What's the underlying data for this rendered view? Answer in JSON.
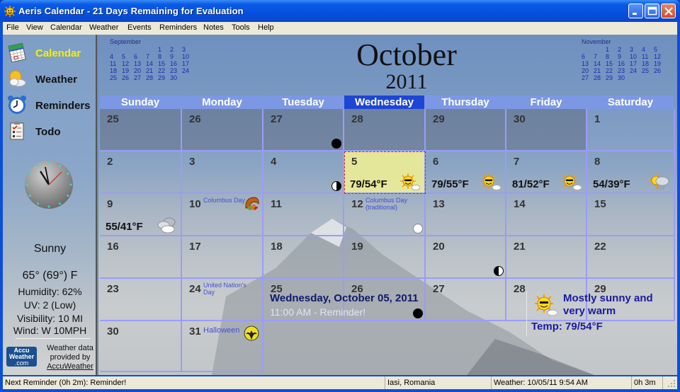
{
  "window": {
    "title": "Aeris Calendar - 21 Days Remaining for Evaluation",
    "buttons": {
      "minimize": "minimize",
      "maximize": "maximize",
      "close": "close"
    }
  },
  "menu": [
    "File",
    "View",
    "Calendar",
    "Weather",
    "Events",
    "Reminders",
    "Notes",
    "Tools",
    "Help"
  ],
  "sidebar": {
    "nav": [
      {
        "label": "Calendar",
        "icon": "calendar-icon",
        "active": true
      },
      {
        "label": "Weather",
        "icon": "weather-icon",
        "active": false
      },
      {
        "label": "Reminders",
        "icon": "alarm-clock-icon",
        "active": false
      },
      {
        "label": "Todo",
        "icon": "todo-checklist-icon",
        "active": false
      }
    ],
    "weather": {
      "condition": "Sunny",
      "temperature": "65° (69°) F",
      "humidity": "Humidity: 62%",
      "uv": "UV: 2 (Low)",
      "visibility": "Visibility: 10 MI",
      "wind": "Wind: W 10MPH"
    },
    "provider": {
      "logo_line1": "Accu",
      "logo_line2": "Weather",
      "logo_line3": ".com",
      "text1": "Weather data",
      "text2": "provided by",
      "link": "AccuWeather"
    }
  },
  "mini_calendars": {
    "prev": {
      "name": "September",
      "weeks": [
        [
          "",
          "",
          "",
          "",
          "1",
          "2",
          "3"
        ],
        [
          "4",
          "5",
          "6",
          "7",
          "8",
          "9",
          "10"
        ],
        [
          "11",
          "12",
          "13",
          "14",
          "15",
          "16",
          "17"
        ],
        [
          "18",
          "19",
          "20",
          "21",
          "22",
          "23",
          "24"
        ],
        [
          "25",
          "26",
          "27",
          "28",
          "29",
          "30",
          ""
        ]
      ]
    },
    "next": {
      "name": "November",
      "weeks": [
        [
          "",
          "",
          "1",
          "2",
          "3",
          "4",
          "5"
        ],
        [
          "6",
          "7",
          "8",
          "9",
          "10",
          "11",
          "12"
        ],
        [
          "13",
          "14",
          "15",
          "16",
          "17",
          "18",
          "19"
        ],
        [
          "20",
          "21",
          "22",
          "23",
          "24",
          "25",
          "26"
        ],
        [
          "27",
          "28",
          "29",
          "30",
          "",
          "",
          ""
        ]
      ]
    }
  },
  "calendar": {
    "month": "October",
    "year": "2011",
    "weekdays": [
      "Sunday",
      "Monday",
      "Tuesday",
      "Wednesday",
      "Thursday",
      "Friday",
      "Saturday"
    ],
    "today_weekday_index": 3,
    "weeks": [
      [
        {
          "d": "25",
          "other": true
        },
        {
          "d": "26",
          "other": true
        },
        {
          "d": "27",
          "other": true,
          "moon": "new"
        },
        {
          "d": "28",
          "other": true
        },
        {
          "d": "29",
          "other": true
        },
        {
          "d": "30",
          "other": true
        },
        {
          "d": "1"
        }
      ],
      [
        {
          "d": "2"
        },
        {
          "d": "3"
        },
        {
          "d": "4",
          "moon": "first"
        },
        {
          "d": "5",
          "today": true,
          "temp": "79/54°F",
          "weather": "sunny-partly-cloudy"
        },
        {
          "d": "6",
          "temp": "79/55°F",
          "weather": "sunny-partly-cloudy"
        },
        {
          "d": "7",
          "temp": "81/52°F",
          "weather": "sunny-partly-cloudy"
        },
        {
          "d": "8",
          "temp": "54/39°F",
          "weather": "thunderstorm"
        }
      ],
      [
        {
          "d": "9",
          "temp": "55/41°F",
          "weather": "cloudy"
        },
        {
          "d": "10",
          "event": "Columbus Day",
          "holiday_icon": "cornucopia"
        },
        {
          "d": "11"
        },
        {
          "d": "12",
          "event": "Columbus Day (traditional)",
          "moon": "full"
        },
        {
          "d": "13"
        },
        {
          "d": "14"
        },
        {
          "d": "15"
        }
      ],
      [
        {
          "d": "16"
        },
        {
          "d": "17"
        },
        {
          "d": "18"
        },
        {
          "d": "19"
        },
        {
          "d": "20",
          "moon": "last"
        },
        {
          "d": "21"
        },
        {
          "d": "22"
        }
      ],
      [
        {
          "d": "23"
        },
        {
          "d": "24",
          "event": "United Nation's Day"
        },
        {
          "d": "25"
        },
        {
          "d": "26",
          "moon": "new"
        },
        {
          "d": "27"
        },
        {
          "d": "28"
        },
        {
          "d": "29"
        }
      ],
      [
        {
          "d": "30"
        },
        {
          "d": "31",
          "event": "Halloween",
          "holiday_icon": "halloween-bat"
        }
      ]
    ]
  },
  "detail": {
    "date": "Wednesday, October 05, 2011",
    "reminder": "11:00 AM - Reminder!",
    "forecast": "Mostly sunny and very warm",
    "temp": "Temp: 79/54°F"
  },
  "status": {
    "next_reminder": "Next Reminder (0h 2m): Reminder!",
    "location": "Iasi, Romania",
    "weather_updated": "Weather: 10/05/11 9:54 AM",
    "elapsed": "0h 3m"
  }
}
